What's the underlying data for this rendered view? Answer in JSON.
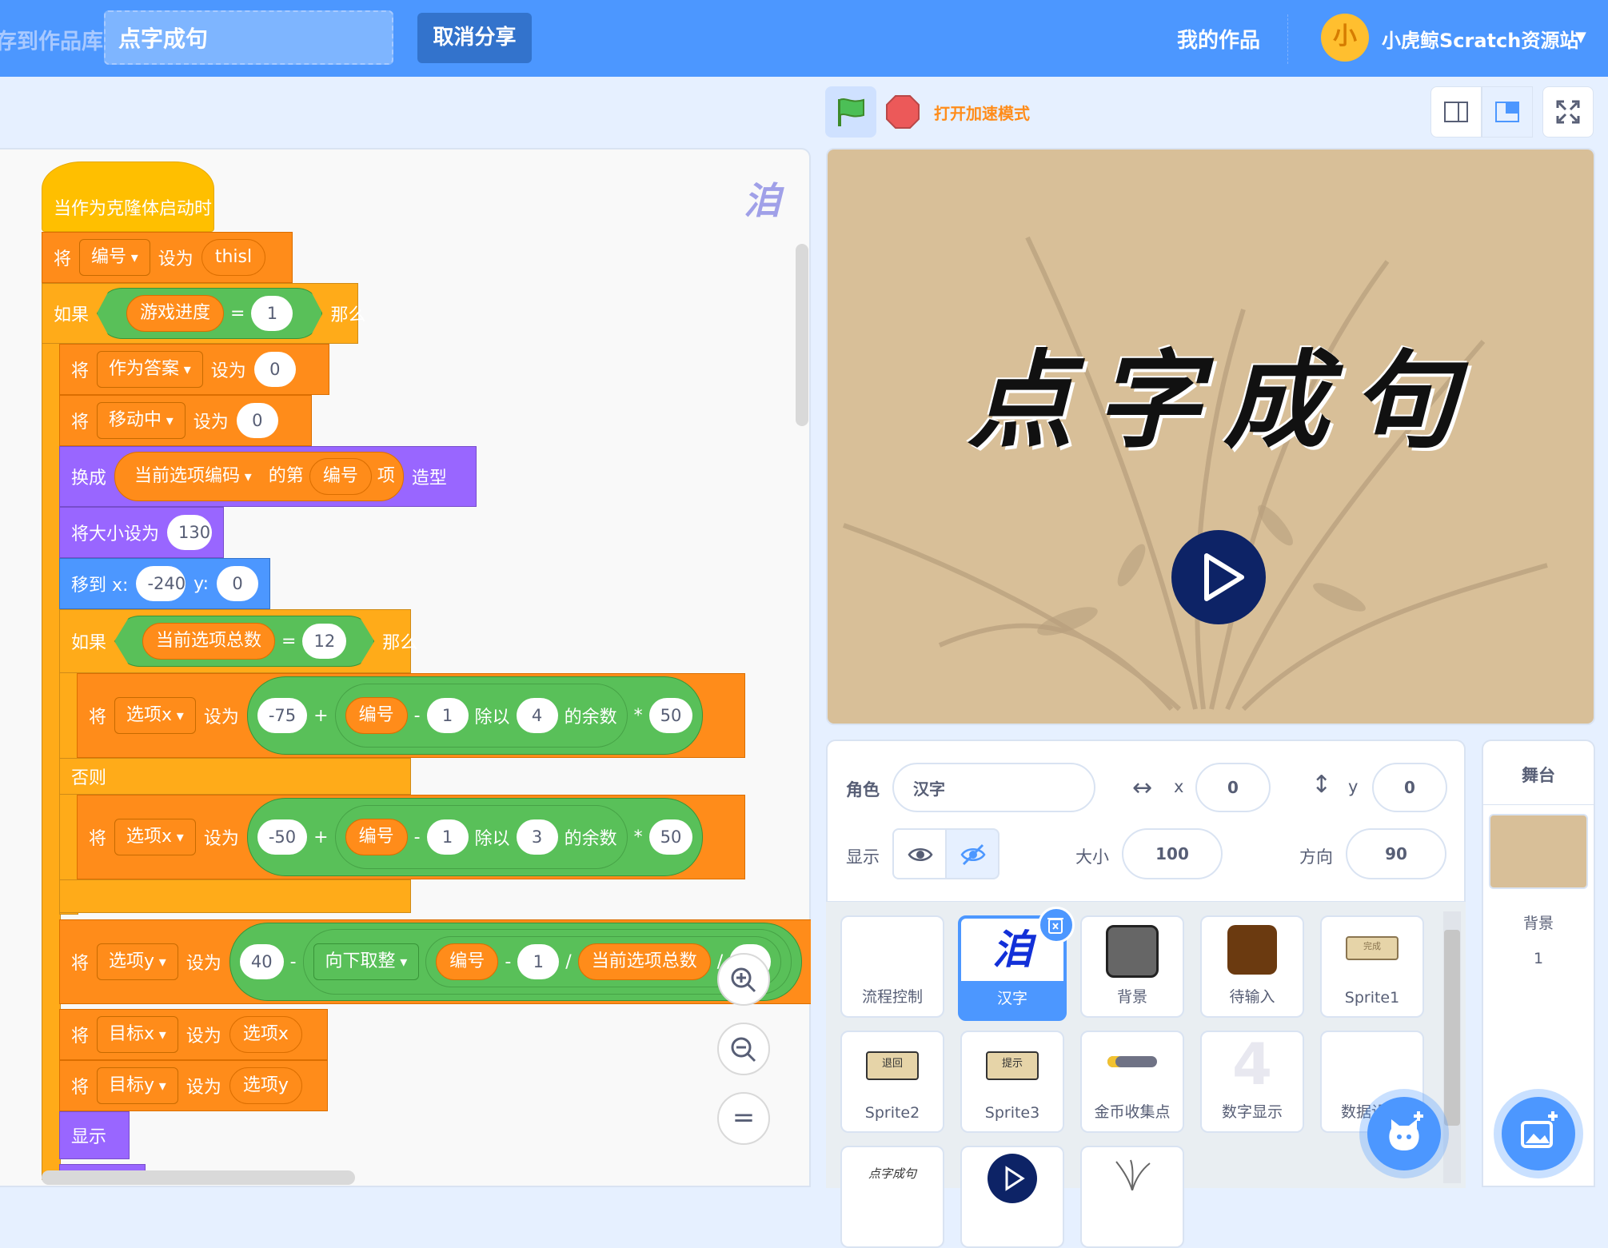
{
  "menu": {
    "save_to_library": "存到作品库",
    "project_title": "点字成句",
    "unshare": "取消分享",
    "my_works": "我的作品",
    "avatar_text": "小",
    "site_name": "小虎鲸Scratch资源站"
  },
  "stage_header": {
    "turbo_label": "打开加速模式"
  },
  "stage": {
    "title_text": "点字成句"
  },
  "code": {
    "watermark": "洎",
    "hat": "当作为克隆体启动时",
    "b1": {
      "set": "将",
      "var": "编号",
      "to": "设为",
      "val": "thisl"
    },
    "if1": {
      "if": "如果",
      "var": "游戏进度",
      "eq": "=",
      "val": "1",
      "then": "那么"
    },
    "b2": {
      "set": "将",
      "var": "作为答案",
      "to": "设为",
      "val": "0"
    },
    "b3": {
      "set": "将",
      "var": "移动中",
      "to": "设为",
      "val": "0"
    },
    "b4": {
      "switch": "换成",
      "list": "当前选项编码",
      "of": "的第",
      "idx": "编号",
      "item": "项",
      "costume": "造型"
    },
    "b5": {
      "label": "将大小设为",
      "val": "130"
    },
    "b6": {
      "label": "移到 x:",
      "x": "-240",
      "ylabel": "y:",
      "y": "0"
    },
    "if2": {
      "if": "如果",
      "var": "当前选项总数",
      "eq": "=",
      "val": "12",
      "then": "那么"
    },
    "b7": {
      "set": "将",
      "var": "选项x",
      "to": "设为",
      "a": "-75",
      "plus": "+",
      "v": "编号",
      "minus": "-",
      "one": "1",
      "mod": "除以",
      "n": "4",
      "rem": "的余数",
      "times": "*",
      "m": "50"
    },
    "else": "否则",
    "b8": {
      "set": "将",
      "var": "选项x",
      "to": "设为",
      "a": "-50",
      "plus": "+",
      "v": "编号",
      "minus": "-",
      "one": "1",
      "mod": "除以",
      "n": "3",
      "rem": "的余数",
      "times": "*",
      "m": "50"
    },
    "b9": {
      "set": "将",
      "var": "选项y",
      "to": "设为",
      "a": "40",
      "minus": "-",
      "floor": "向下取整",
      "v": "编号",
      "minus2": "-",
      "one": "1",
      "div": "/",
      "total": "当前选项总数",
      "div2": "/",
      "three": "3"
    },
    "b10": {
      "set": "将",
      "var": "目标x",
      "to": "设为",
      "val": "选项x"
    },
    "b11": {
      "set": "将",
      "var": "目标y",
      "to": "设为",
      "val": "选项y"
    },
    "b12": "显示",
    "zoom_reset": "="
  },
  "sprite_info": {
    "sprite_label": "角色",
    "sprite_name": "汉字",
    "x_label": "x",
    "x_value": "0",
    "y_label": "y",
    "y_value": "0",
    "show_label": "显示",
    "size_label": "大小",
    "size_value": "100",
    "direction_label": "方向",
    "direction_value": "90"
  },
  "sprites": [
    {
      "name": "流程控制",
      "icon": "blank"
    },
    {
      "name": "汉字",
      "icon": "hanzi-glyph",
      "glyph": "洎",
      "selected": true
    },
    {
      "name": "背景",
      "icon": "gray-square"
    },
    {
      "name": "待输入",
      "icon": "brown-square"
    },
    {
      "name": "Sprite1",
      "icon": "plaque",
      "glyph": "完成"
    },
    {
      "name": "Sprite2",
      "icon": "plaque",
      "glyph": "退回"
    },
    {
      "name": "Sprite3",
      "icon": "plaque",
      "glyph": "提示"
    },
    {
      "name": "金币收集点",
      "icon": "bar"
    },
    {
      "name": "数字显示",
      "icon": "digit",
      "glyph": "4"
    },
    {
      "name": "数据设",
      "icon": "blank"
    },
    {
      "name": "",
      "icon": "small-title",
      "glyph": "点字成句"
    },
    {
      "name": "",
      "icon": "play-circle"
    },
    {
      "name": "",
      "icon": "orchid"
    }
  ],
  "stage_panel": {
    "title": "舞台",
    "backdrops_label": "背景",
    "backdrops_count": "1"
  },
  "colors": {
    "menu_blue": "#4c97ff",
    "stage_bg": "#d8bf98",
    "var_orange": "#ff8c1a",
    "control_yellow": "#ffab19",
    "looks_purple": "#9966ff",
    "operator_green": "#59c059"
  }
}
